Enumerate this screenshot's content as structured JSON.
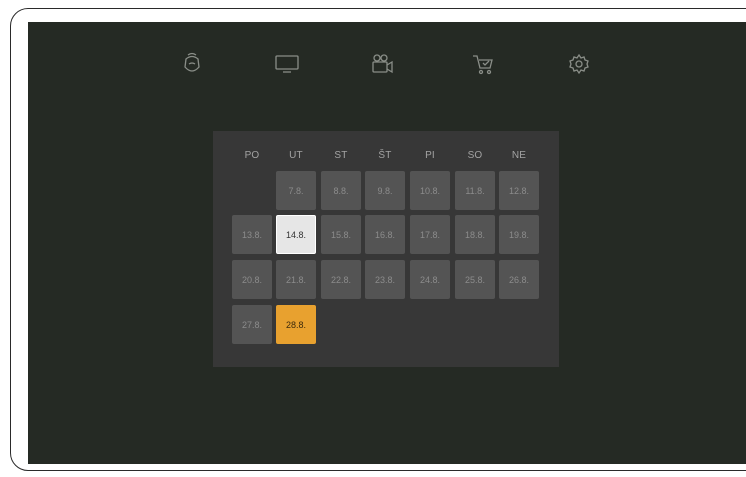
{
  "nav": {
    "icons": [
      "voice-assistant-icon",
      "tv-icon",
      "video-camera-icon",
      "shopping-cart-icon",
      "settings-gear-icon"
    ]
  },
  "calendar": {
    "weekdays": [
      "PO",
      "UT",
      "ST",
      "ŠT",
      "PI",
      "SO",
      "NE"
    ],
    "rows": [
      [
        "",
        "7.8.",
        "8.8.",
        "9.8.",
        "10.8.",
        "11.8.",
        "12.8."
      ],
      [
        "13.8.",
        "14.8.",
        "15.8.",
        "16.8.",
        "17.8.",
        "18.8.",
        "19.8."
      ],
      [
        "20.8.",
        "21.8.",
        "22.8.",
        "23.8.",
        "24.8.",
        "25.8.",
        "26.8."
      ],
      [
        "27.8.",
        "28.8.",
        "",
        "",
        "",
        "",
        ""
      ]
    ],
    "selected": "14.8.",
    "today": "28.8."
  },
  "colors": {
    "screen_bg": "#252a24",
    "panel_bg": "#373737",
    "day_bg": "#545454",
    "selected_bg": "#e6e6e6",
    "today_bg": "#e8a12f"
  }
}
